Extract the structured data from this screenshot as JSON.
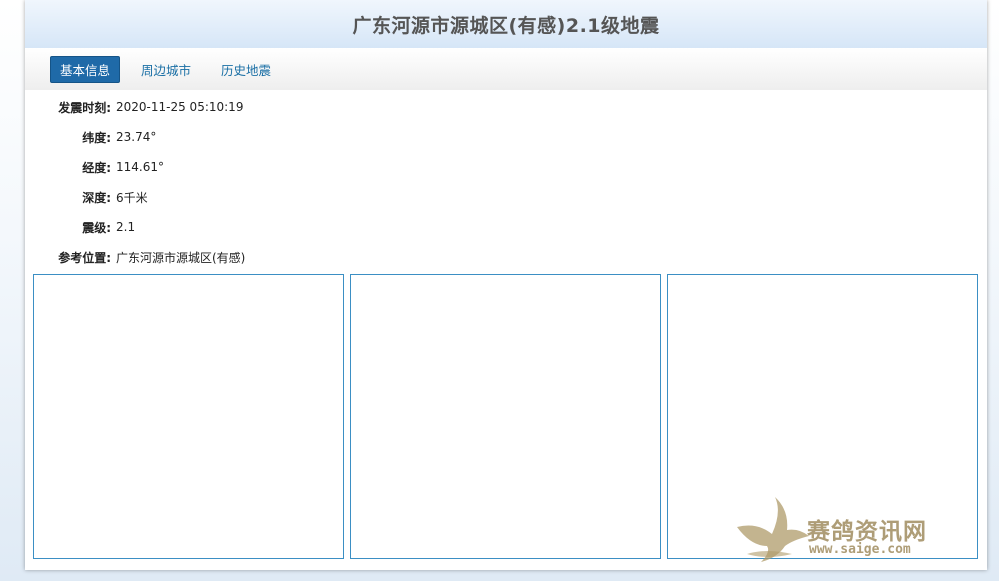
{
  "header": {
    "title": "广东河源市源城区(有感)2.1级地震"
  },
  "tabs": [
    {
      "label": "基本信息",
      "active": true
    },
    {
      "label": "周边城市",
      "active": false
    },
    {
      "label": "历史地震",
      "active": false
    }
  ],
  "info": [
    {
      "label": "发震时刻:",
      "value": "2020-11-25 05:10:19"
    },
    {
      "label": "纬度:",
      "value": "23.74°"
    },
    {
      "label": "经度:",
      "value": "114.61°"
    },
    {
      "label": "深度:",
      "value": "6千米"
    },
    {
      "label": "震级:",
      "value": "2.1"
    },
    {
      "label": "参考位置:",
      "value": "广东河源市源城区(有感)"
    }
  ],
  "watermark": {
    "text": "赛鸽资讯网",
    "url": "www.saige.com"
  },
  "colors": {
    "accent": "#1f6aa8",
    "panel_border": "#3b8fc4",
    "tab_link": "#1a6fa5"
  }
}
